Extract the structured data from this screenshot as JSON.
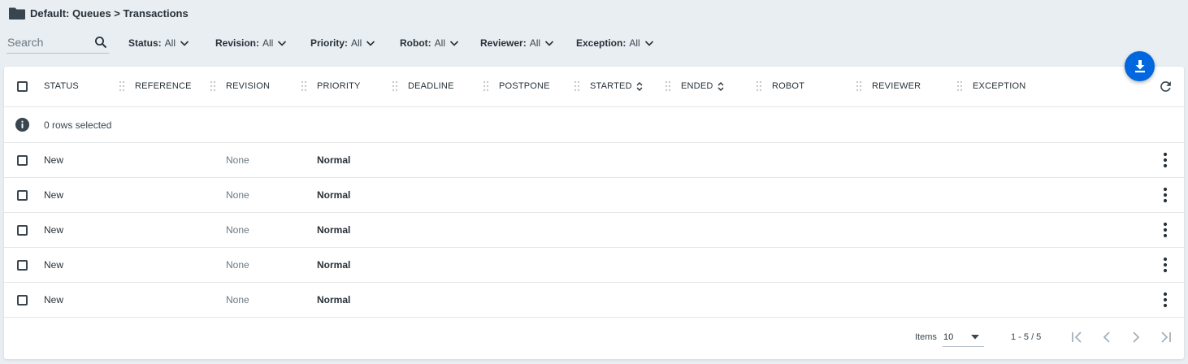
{
  "breadcrumb": {
    "text": "Default: Queues > Transactions",
    "icon": "folder-icon"
  },
  "search": {
    "placeholder": "Search",
    "value": ""
  },
  "filters": [
    {
      "name": "Status:",
      "value": "All"
    },
    {
      "name": "Revision:",
      "value": "All"
    },
    {
      "name": "Priority:",
      "value": "All"
    },
    {
      "name": "Robot:",
      "value": "All"
    },
    {
      "name": "Reviewer:",
      "value": "All"
    },
    {
      "name": "Exception:",
      "value": "All"
    }
  ],
  "table": {
    "columns": [
      "STATUS",
      "REFERENCE",
      "REVISION",
      "PRIORITY",
      "DEADLINE",
      "POSTPONE",
      "STARTED",
      "ENDED",
      "ROBOT",
      "REVIEWER",
      "EXCEPTION"
    ],
    "sortable_columns": [
      "STARTED",
      "ENDED"
    ],
    "selection_info": "0 rows selected",
    "rows": [
      {
        "status": "New",
        "reference": "",
        "revision": "None",
        "priority": "Normal"
      },
      {
        "status": "New",
        "reference": "",
        "revision": "None",
        "priority": "Normal"
      },
      {
        "status": "New",
        "reference": "",
        "revision": "None",
        "priority": "Normal"
      },
      {
        "status": "New",
        "reference": "",
        "revision": "None",
        "priority": "Normal"
      },
      {
        "status": "New",
        "reference": "",
        "revision": "None",
        "priority": "Normal"
      }
    ]
  },
  "footer": {
    "items_label": "Items",
    "items_per_page": "10",
    "range": "1 - 5 / 5"
  },
  "colors": {
    "accent": "#0067df",
    "background": "#e9eef2",
    "text": "#273139"
  }
}
